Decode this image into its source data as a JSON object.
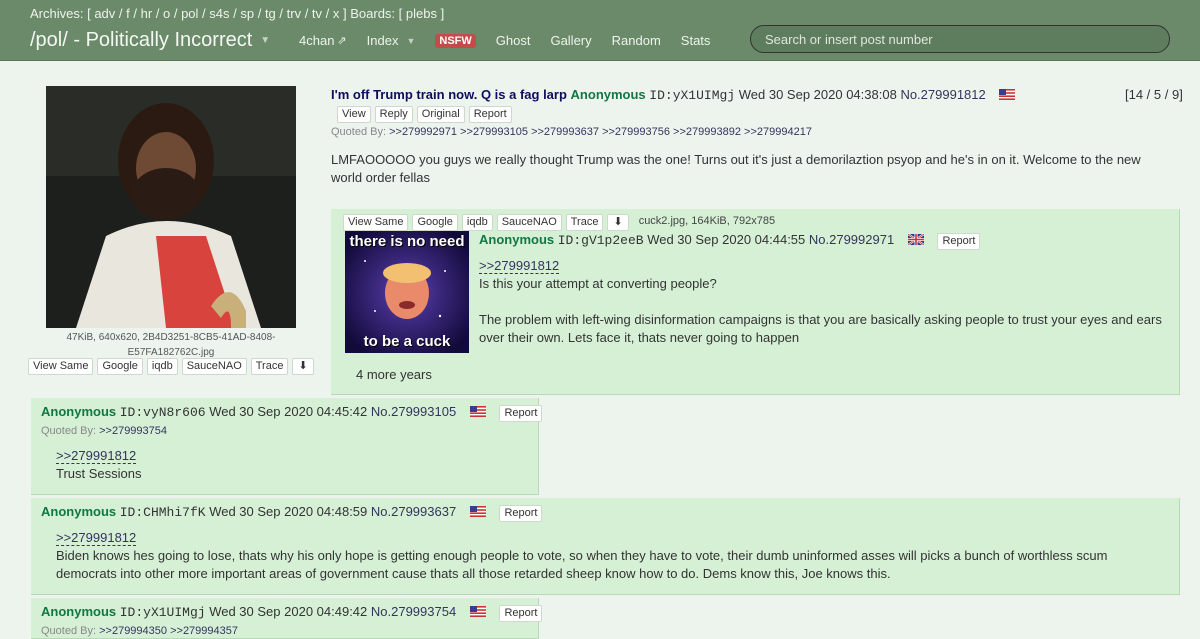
{
  "nav": {
    "archives_label": "Archives: [",
    "archives": [
      "adv",
      "f",
      "hr",
      "o",
      "pol",
      "s4s",
      "sp",
      "tg",
      "trv",
      "tv",
      "x"
    ],
    "boards_label": "] Boards: [",
    "boards": [
      "plebs"
    ],
    "close_bracket": "]",
    "board_title": "/pol/ - Politically Incorrect",
    "links": {
      "site": "4chan",
      "index": "Index",
      "nsfw": "NSFW",
      "ghost": "Ghost",
      "gallery": "Gallery",
      "random": "Random",
      "stats": "Stats"
    },
    "search_placeholder": "Search or insert post number"
  },
  "op": {
    "subject": "I'm off Trump train now. Q is a fag larp",
    "name": "Anonymous",
    "id": "ID:yX1UIMgj",
    "date": "Wed 30 Sep 2020 04:38:08",
    "no": "No.279991812",
    "counts": "[14 / 5 / 9]",
    "actions": [
      "View",
      "Reply",
      "Original",
      "Report"
    ],
    "quoted_by_label": "Quoted By:",
    "quoted_by": [
      ">>279992971",
      ">>279993105",
      ">>279993637",
      ">>279993756",
      ">>279993892",
      ">>279994217"
    ],
    "body": "LMFAOOOOO you guys we really thought Trump was the one! Turns out it's just a demorilaztion psyop and he's in on it. Welcome to the new world order fellas",
    "file_info_1": "47KiB, 640x620, 2B4D3251-8CB5-41AD-8408-",
    "file_info_2": "E57FA182762C.jpg",
    "image_actions": [
      "View Same",
      "Google",
      "iqdb",
      "SauceNAO",
      "Trace"
    ],
    "flag": "us-flag"
  },
  "replies": [
    {
      "name": "Anonymous",
      "id": "ID:gV1p2eeB",
      "date": "Wed 30 Sep 2020 04:44:55",
      "no": "No.279992971",
      "report": "Report",
      "flag": "uk-flag",
      "image_actions": [
        "View Same",
        "Google",
        "iqdb",
        "SauceNAO",
        "Trace"
      ],
      "file_info": "cuck2.jpg, 164KiB, 792x785",
      "thumb_text_top": "there is no need",
      "thumb_text_bottom": "to be a cuck",
      "quote": ">>279991812",
      "line1": "Is this your attempt at converting people?",
      "line2": "The problem with left-wing disinformation campaigns is that you are basically asking people to trust your eyes and ears over their own. Lets face it, thats never going to happen",
      "line3": "4 more years"
    },
    {
      "name": "Anonymous",
      "id": "ID:vyN8r606",
      "date": "Wed 30 Sep 2020 04:45:42",
      "no": "No.279993105",
      "report": "Report",
      "flag": "us-flag",
      "quoted_by_label": "Quoted By:",
      "quoted_by": [
        ">>279993754"
      ],
      "quote": ">>279991812",
      "body": "Trust Sessions"
    },
    {
      "name": "Anonymous",
      "id": "ID:CHMhi7fK",
      "date": "Wed 30 Sep 2020 04:48:59",
      "no": "No.279993637",
      "report": "Report",
      "flag": "us-flag",
      "quote": ">>279991812",
      "body": "Biden knows hes going to lose, thats why his only hope is getting enough people to vote, so when they have to vote, their dumb uninformed asses will picks a bunch of worthless scum democrats into other more important areas of government cause thats all those retarded sheep know how to do. Dems know this, Joe knows this."
    },
    {
      "name": "Anonymous",
      "id": "ID:yX1UIMgj",
      "date": "Wed 30 Sep 2020 04:49:42",
      "no": "No.279993754",
      "report": "Report",
      "flag": "us-flag",
      "quoted_by_label": "Quoted By:",
      "quoted_by": [
        ">>279994350",
        ">>279994357"
      ]
    }
  ],
  "colors": {
    "navbar": "#6a8a6a",
    "reply_bg": "#d6f0d6",
    "name": "#117743",
    "subject": "#0f0c5d",
    "nsfw": "#c74a4a"
  }
}
